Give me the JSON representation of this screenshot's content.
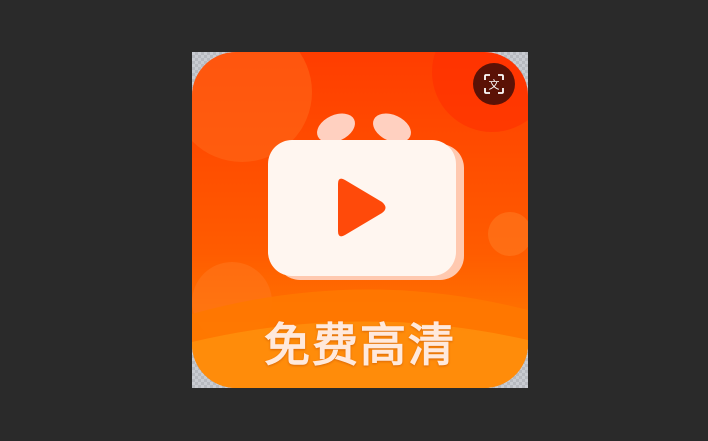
{
  "icon": {
    "label": "免费高清",
    "colors": {
      "top_gradient": "#ff3d00",
      "bottom_gradient": "#ff8a00",
      "tv_body": "#fff6f0",
      "play": "#ff4a0a"
    }
  },
  "toolbar": {
    "ocr_button_icon": "text-scan-icon",
    "ocr_glyph": "文",
    "ocr_button_color": "#5b1206"
  }
}
